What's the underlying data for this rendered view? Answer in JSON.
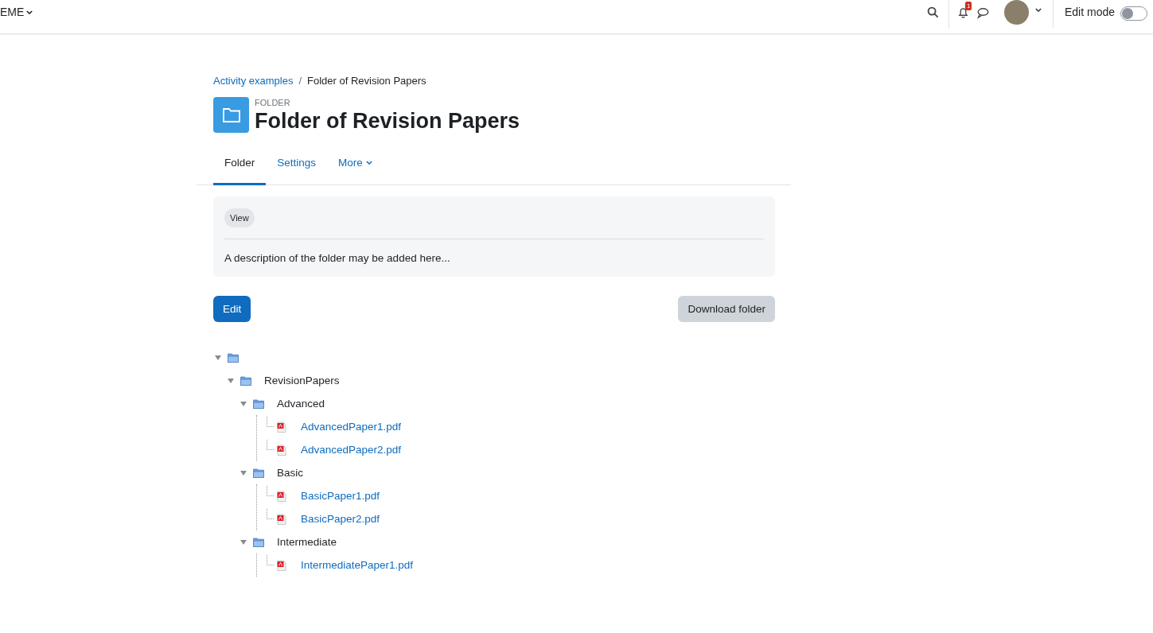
{
  "navbar": {
    "site_menu": "EME",
    "notification_count": "1",
    "edit_mode": {
      "label": "Edit mode",
      "on": false
    }
  },
  "breadcrumb_separator": "/",
  "breadcrumb": [
    {
      "label": "Activity examples",
      "kind": "link"
    },
    {
      "label": "Folder of Revision Papers",
      "kind": "current"
    }
  ],
  "header": {
    "type_label": "FOLDER",
    "title": "Folder of Revision Papers"
  },
  "tabs": [
    {
      "label": "Folder",
      "selected": true,
      "dropdown": false
    },
    {
      "label": "Settings",
      "selected": false,
      "dropdown": false
    },
    {
      "label": "More",
      "selected": false,
      "dropdown": true
    }
  ],
  "description": {
    "badge": "View",
    "text": "A description of the folder may be added here..."
  },
  "buttons": {
    "edit": "Edit",
    "download": "Download folder"
  },
  "tree": [
    {
      "kind": "folder",
      "expanded": true,
      "children": [
        {
          "kind": "folder",
          "name": "RevisionPapers",
          "expanded": true,
          "children": [
            {
              "kind": "folder",
              "name": "Advanced",
              "expanded": true,
              "children": [
                {
                  "kind": "file",
                  "name": "AdvancedPaper1.pdf"
                },
                {
                  "kind": "file",
                  "name": "AdvancedPaper2.pdf"
                }
              ]
            },
            {
              "kind": "folder",
              "name": "Basic",
              "expanded": true,
              "children": [
                {
                  "kind": "file",
                  "name": "BasicPaper1.pdf"
                },
                {
                  "kind": "file",
                  "name": "BasicPaper2.pdf"
                }
              ]
            },
            {
              "kind": "folder",
              "name": "Intermediate",
              "expanded": true,
              "children": [
                {
                  "kind": "file",
                  "name": "IntermediatePaper1.pdf"
                }
              ]
            }
          ]
        }
      ]
    }
  ]
}
